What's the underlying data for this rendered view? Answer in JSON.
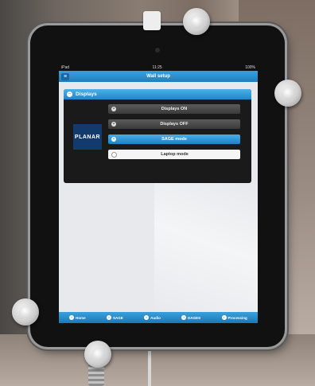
{
  "status_bar": {
    "device": "iPad",
    "time": "11:25",
    "battery": "100%"
  },
  "navbar": {
    "title": "Wall setup",
    "menu_icon": "menu-icon"
  },
  "panel": {
    "title": "Displays",
    "logo_text": "PLANAR",
    "buttons": [
      {
        "label": "Displays ON",
        "state": "default"
      },
      {
        "label": "Displays OFF",
        "state": "default"
      },
      {
        "label": "SAGE mode",
        "state": "active"
      },
      {
        "label": "Laptop mode",
        "state": "light"
      }
    ]
  },
  "tabbar": {
    "tabs": [
      {
        "label": "Home",
        "icon": "home-icon"
      },
      {
        "label": "SAGE",
        "icon": "sage-icon"
      },
      {
        "label": "Audio",
        "icon": "audio-icon"
      },
      {
        "label": "DAGES",
        "icon": "dages-icon"
      },
      {
        "label": "Processing",
        "icon": "processing-icon"
      }
    ]
  },
  "colors": {
    "accent": "#1f86c8",
    "panel_bg": "#1a1a1a",
    "screen_bg": "#e7e9ec"
  }
}
